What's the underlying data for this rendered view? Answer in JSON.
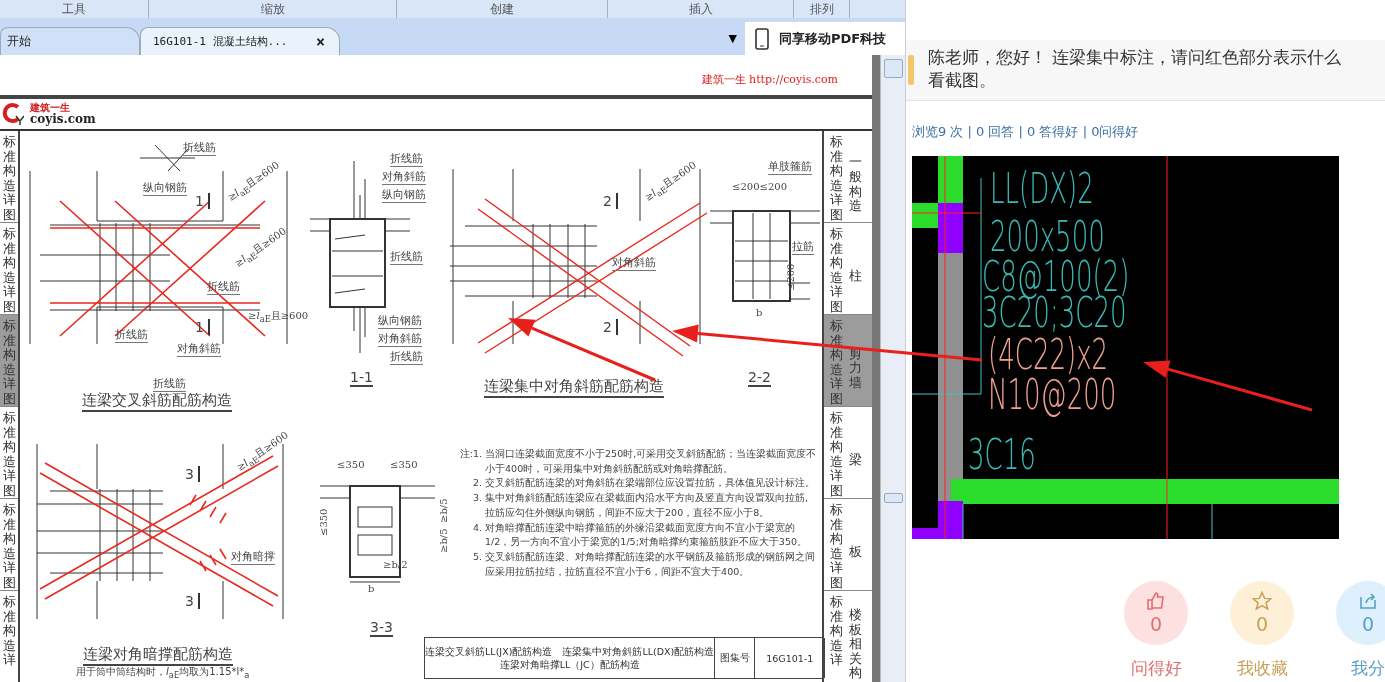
{
  "ribbon_groups": [
    "工具",
    "缩放",
    "创建",
    "插入",
    "排列"
  ],
  "tabs": [
    {
      "label": "开始",
      "selected": false,
      "closable": false
    },
    {
      "label": "16G101-1 混凝土结构...",
      "selected": true,
      "closable": true
    }
  ],
  "tab_close": "×",
  "tab_menu": "▼",
  "promo_button": {
    "label": "同享移动PDF科技"
  },
  "document": {
    "header": "建筑一生 http://coyis.com",
    "logo": {
      "tagline": "建筑一生",
      "site": "coyis.com"
    },
    "left_tabs": [
      {
        "label": "标准构造详图",
        "selected": false
      },
      {
        "label": "标准构造详图",
        "selected": false
      },
      {
        "label": "标准构造详图",
        "selected": true
      },
      {
        "label": "标准构造详图",
        "selected": false
      },
      {
        "label": "标准构造详图",
        "selected": false
      },
      {
        "label": "标准构造详",
        "selected": false
      }
    ],
    "right_tabs": [
      {
        "label": "标准构造详图",
        "section": "一般构造",
        "selected": false
      },
      {
        "label": "标准构造详图",
        "section": "柱",
        "selected": false
      },
      {
        "label": "标准构造详图",
        "section": "剪力墙",
        "selected": true
      },
      {
        "label": "标准构造详图",
        "section": "梁",
        "selected": false
      },
      {
        "label": "标准构造详图",
        "section": "板",
        "selected": false
      },
      {
        "label": "标准构造详",
        "section": "楼板相关构",
        "selected": false
      }
    ],
    "labels": [
      {
        "text": "折线筋",
        "kind": "label"
      },
      {
        "text": "纵向钢筋",
        "kind": "label"
      },
      {
        "text": "1",
        "kind": "mark"
      },
      {
        "text": "≥*l*$_{aE}$且≥600",
        "kind": "dimension"
      },
      {
        "text": "折线筋",
        "kind": "label"
      },
      {
        "text": "≥*l*$_{aE}$且≥600",
        "kind": "dimension"
      },
      {
        "text": "≥*l*$_{aE}$且≥600",
        "kind": "dimension"
      },
      {
        "text": "折线筋",
        "kind": "label"
      },
      {
        "text": "1",
        "kind": "mark"
      },
      {
        "text": "对角斜筋",
        "kind": "label"
      },
      {
        "text": "折线筋",
        "kind": "label"
      },
      {
        "text": "连梁交叉斜筋配筋构造",
        "kind": "title"
      },
      {
        "text": "折线筋",
        "kind": "label"
      },
      {
        "text": "对角斜筋",
        "kind": "label"
      },
      {
        "text": "纵向钢筋",
        "kind": "label"
      },
      {
        "text": "折线筋",
        "kind": "label"
      },
      {
        "text": "纵向钢筋",
        "kind": "label"
      },
      {
        "text": "对角斜筋",
        "kind": "label"
      },
      {
        "text": "折线筋",
        "kind": "label"
      },
      {
        "text": "1-1",
        "kind": "section"
      },
      {
        "text": "2",
        "kind": "mark"
      },
      {
        "text": "2",
        "kind": "mark"
      },
      {
        "text": "≥*l*$_{aE}$且≥600",
        "kind": "dimension"
      },
      {
        "text": "对角斜筋",
        "kind": "label"
      },
      {
        "text": "连梁集中对角斜筋配筋构造",
        "kind": "title"
      },
      {
        "text": "单肢箍筋",
        "kind": "label"
      },
      {
        "text": "≤200≤200",
        "kind": "dimension"
      },
      {
        "text": "拉筋",
        "kind": "label"
      },
      {
        "text": "≤200",
        "kind": "dimension"
      },
      {
        "text": "b",
        "kind": "dimension"
      },
      {
        "text": "2-2",
        "kind": "section"
      },
      {
        "text": "3",
        "kind": "mark"
      },
      {
        "text": "3",
        "kind": "mark"
      },
      {
        "text": "≥*l*$_{aE}$且≥600",
        "kind": "dimension"
      },
      {
        "text": "对角暗撑",
        "kind": "label"
      },
      {
        "text": "连梁对角暗撑配筋构造",
        "kind": "title"
      },
      {
        "text": "用于筒中筒结构时，*l*$_{aE}$均取为1.15*l*$_{a}$",
        "kind": "caption"
      },
      {
        "text": "≤350",
        "kind": "dimension"
      },
      {
        "text": "≤350",
        "kind": "dimension"
      },
      {
        "text": "≤350",
        "kind": "dimension"
      },
      {
        "text": "≥b/5",
        "kind": "dimension"
      },
      {
        "text": "≥b/5",
        "kind": "dimension"
      },
      {
        "text": "≥b/2",
        "kind": "dimension"
      },
      {
        "text": "b",
        "kind": "dimension"
      },
      {
        "text": "3-3",
        "kind": "section"
      }
    ],
    "notes": [
      {
        "number": "注:1.",
        "text": "当洞口连梁截面宽度不小于250时,可采用交叉斜筋配筋；当连梁截面宽度不小于400时，可采用集中对角斜筋配筋或对角暗撑配筋。"
      },
      {
        "number": "2.",
        "text": "交叉斜筋配筋连梁的对角斜筋在梁端部位应设置拉筋，具体值见设计标注。"
      },
      {
        "number": "3.",
        "text": "集中对角斜筋配筋连梁应在梁截面内沿水平方向及竖直方向设置双向拉筋,拉筋应勾住外侧纵向钢筋，间距不应大于200，直径不应小于8。"
      },
      {
        "number": "4.",
        "text": "对角暗撑配筋连梁中暗撑箍筋的外缘沿梁截面宽度方向不宜小于梁宽的1/2，另一方向不宜小于梁宽的1/5;对角暗撑约束箍筋肢距不应大于350。"
      },
      {
        "number": "5.",
        "text": "交叉斜筋配筋连梁、对角暗撑配筋连梁的水平钢筋及箍筋形成的钢筋网之间应采用拉筋拉结，拉筋直径不宜小于6，间距不宜大于400。"
      }
    ],
    "title_block": {
      "titles": [
        "连梁交叉斜筋LL(JX)配筋构造　连梁集中对角斜筋LL(DX)配筋构造",
        "连梁对角暗撑LL（JC）配筋构造"
      ],
      "atlas_label": "图集号",
      "atlas_number": "16G101-1"
    }
  },
  "question": {
    "lines": [
      "陈老师，您好！ 连梁集中标注，请问红色部分表示什么",
      "看截图。"
    ]
  },
  "stats": "浏览9 次 | 0 回答 | 0 答得好 | 0问得好",
  "cad_image": {
    "annotations": [
      {
        "text": "LL(DX)2",
        "color": "#3ab8b4"
      },
      {
        "text": "200x500",
        "color": "#3ab8b4"
      },
      {
        "text": "C8@100(2)",
        "color": "#3ab8b4"
      },
      {
        "text": "3C20;3C20",
        "color": "#3ab8b4"
      },
      {
        "text": "(4C22)x2",
        "color": "#f0a090"
      },
      {
        "text": "N10@200",
        "color": "#f0a090"
      },
      {
        "text": "3C16",
        "color": "#3ab8b4"
      }
    ]
  },
  "actions": [
    {
      "kind": "like",
      "count": "0",
      "label": "问得好"
    },
    {
      "kind": "favorite",
      "count": "0",
      "label": "我收藏"
    },
    {
      "kind": "share",
      "count": "0",
      "label": "我分"
    }
  ]
}
